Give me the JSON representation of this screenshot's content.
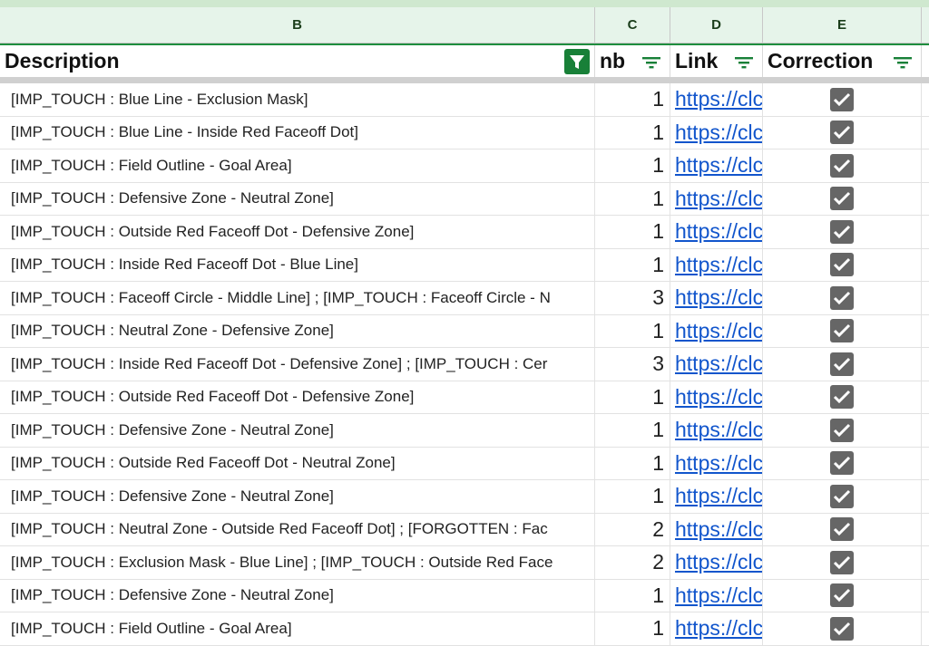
{
  "columns": {
    "b": "B",
    "c": "C",
    "d": "D",
    "e": "E"
  },
  "headers": {
    "description": "Description",
    "nb": "nb",
    "link": "Link",
    "correction": "Correction"
  },
  "colors": {
    "filter_active": "#188038",
    "link": "#1155cc",
    "checkbox": "#666666",
    "header_bg": "#e6f4ea"
  },
  "rows": [
    {
      "description": "[IMP_TOUCH : Blue Line - Exclusion Mask]",
      "nb": "1",
      "link": "https://clc",
      "correction": true
    },
    {
      "description": "[IMP_TOUCH : Blue Line - Inside Red Faceoff Dot]",
      "nb": "1",
      "link": "https://clc",
      "correction": true
    },
    {
      "description": "[IMP_TOUCH : Field Outline - Goal Area]",
      "nb": "1",
      "link": "https://clc",
      "correction": true
    },
    {
      "description": "[IMP_TOUCH : Defensive Zone - Neutral Zone]",
      "nb": "1",
      "link": "https://clc",
      "correction": true
    },
    {
      "description": "[IMP_TOUCH : Outside Red Faceoff Dot - Defensive Zone]",
      "nb": "1",
      "link": "https://clc",
      "correction": true
    },
    {
      "description": "[IMP_TOUCH : Inside Red Faceoff Dot - Blue Line]",
      "nb": "1",
      "link": "https://clc",
      "correction": true
    },
    {
      "description": "[IMP_TOUCH : Faceoff Circle - Middle Line] ; [IMP_TOUCH : Faceoff Circle - N",
      "nb": "3",
      "link": "https://clc",
      "correction": true
    },
    {
      "description": "[IMP_TOUCH : Neutral Zone - Defensive Zone]",
      "nb": "1",
      "link": "https://clc",
      "correction": true
    },
    {
      "description": "[IMP_TOUCH : Inside Red Faceoff Dot - Defensive Zone] ; [IMP_TOUCH : Cer",
      "nb": "3",
      "link": "https://clc",
      "correction": true
    },
    {
      "description": "[IMP_TOUCH : Outside Red Faceoff Dot - Defensive Zone]",
      "nb": "1",
      "link": "https://clc",
      "correction": true
    },
    {
      "description": "[IMP_TOUCH : Defensive Zone - Neutral Zone]",
      "nb": "1",
      "link": "https://clc",
      "correction": true
    },
    {
      "description": "[IMP_TOUCH : Outside Red Faceoff Dot - Neutral Zone]",
      "nb": "1",
      "link": "https://clc",
      "correction": true
    },
    {
      "description": "[IMP_TOUCH : Defensive Zone - Neutral Zone]",
      "nb": "1",
      "link": "https://clc",
      "correction": true
    },
    {
      "description": "[IMP_TOUCH : Neutral Zone - Outside Red Faceoff Dot] ; [FORGOTTEN : Fac",
      "nb": "2",
      "link": "https://clc",
      "correction": true
    },
    {
      "description": "[IMP_TOUCH : Exclusion Mask - Blue Line] ; [IMP_TOUCH : Outside Red Face",
      "nb": "2",
      "link": "https://clc",
      "correction": true
    },
    {
      "description": "[IMP_TOUCH : Defensive Zone - Neutral Zone]",
      "nb": "1",
      "link": "https://clc",
      "correction": true
    },
    {
      "description": "[IMP_TOUCH : Field Outline - Goal Area]",
      "nb": "1",
      "link": "https://clc",
      "correction": true
    }
  ]
}
